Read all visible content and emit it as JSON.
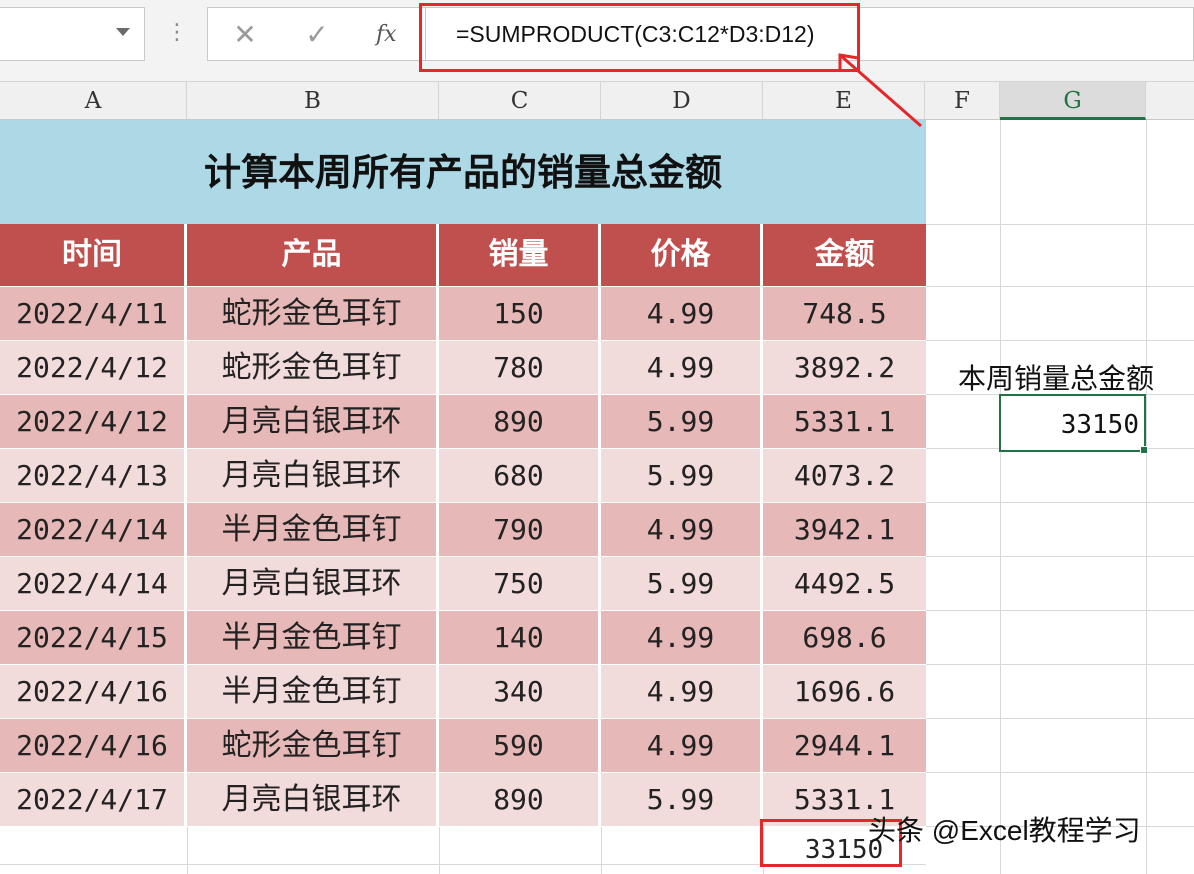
{
  "formula_bar": {
    "cancel_glyph": "✕",
    "enter_glyph": "✓",
    "fx_label": "fx",
    "formula": "=SUMPRODUCT(C3:C12*D3:D12)"
  },
  "columns": [
    "A",
    "B",
    "C",
    "D",
    "E",
    "F",
    "G"
  ],
  "table": {
    "title": "计算本周所有产品的销量总金额",
    "headers": [
      "时间",
      "产品",
      "销量",
      "价格",
      "金额"
    ],
    "rows": [
      [
        "2022/4/11",
        "蛇形金色耳钉",
        "150",
        "4.99",
        "748.5"
      ],
      [
        "2022/4/12",
        "蛇形金色耳钉",
        "780",
        "4.99",
        "3892.2"
      ],
      [
        "2022/4/12",
        "月亮白银耳环",
        "890",
        "5.99",
        "5331.1"
      ],
      [
        "2022/4/13",
        "月亮白银耳环",
        "680",
        "5.99",
        "4073.2"
      ],
      [
        "2022/4/14",
        "半月金色耳钉",
        "790",
        "4.99",
        "3942.1"
      ],
      [
        "2022/4/14",
        "月亮白银耳环",
        "750",
        "5.99",
        "4492.5"
      ],
      [
        "2022/4/15",
        "半月金色耳钉",
        "140",
        "4.99",
        "698.6"
      ],
      [
        "2022/4/16",
        "半月金色耳钉",
        "340",
        "4.99",
        "1696.6"
      ],
      [
        "2022/4/16",
        "蛇形金色耳钉",
        "590",
        "4.99",
        "2944.1"
      ],
      [
        "2022/4/17",
        "月亮白银耳环",
        "890",
        "5.99",
        "5331.1"
      ]
    ],
    "total": "33150"
  },
  "side": {
    "label": "本周销量总金额",
    "value": "33150"
  },
  "watermark": "头条 @Excel教程学习",
  "colors": {
    "title_bg": "#add8e6",
    "header_bg": "#c0504d",
    "row_dark": "#e6b8b7",
    "row_light": "#f2dcdb",
    "highlight": "#e5262b",
    "selection": "#217346"
  }
}
